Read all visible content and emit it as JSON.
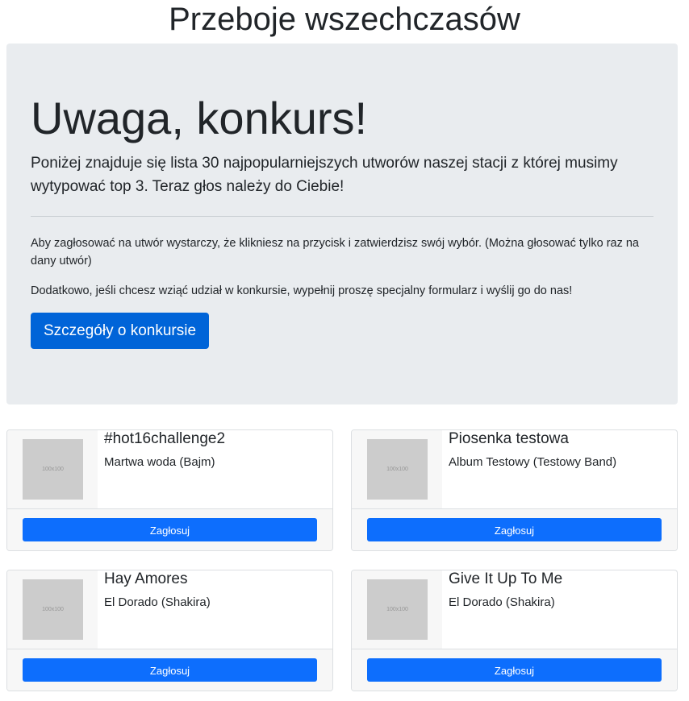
{
  "header": {
    "title": "Przeboje wszechczasów"
  },
  "jumbotron": {
    "heading": "Uwaga, konkurs!",
    "lead": "Poniżej znajduje się lista 30 najpopularniejszych utworów naszej stacji z której musimy wytypować top 3. Teraz głos należy do Ciebie!",
    "info1": "Aby zagłosować na utwór wystarczy, że klikniesz na przycisk i zatwierdzisz swój wybór. (Można głosować tylko raz na dany utwór)",
    "info2": "Dodatkowo, jeśli chcesz wziąć udział w konkursie, wypełnij proszę specjalny formularz i wyślij go do nas!",
    "details_button": "Szczegóły o konkursie"
  },
  "songs": [
    {
      "title": "#hot16challenge2",
      "album": "Martwa woda (Bajm)",
      "thumb": "100x100",
      "vote": "Zagłosuj"
    },
    {
      "title": "Piosenka testowa",
      "album": "Album Testowy (Testowy Band)",
      "thumb": "100x100",
      "vote": "Zagłosuj"
    },
    {
      "title": "Hay Amores",
      "album": "El Dorado (Shakira)",
      "thumb": "100x100",
      "vote": "Zagłosuj"
    },
    {
      "title": "Give It Up To Me",
      "album": "El Dorado (Shakira)",
      "thumb": "100x100",
      "vote": "Zagłosuj"
    }
  ],
  "colors": {
    "primary": "#0d6efd",
    "jumbotron_bg": "#e9ecef"
  }
}
